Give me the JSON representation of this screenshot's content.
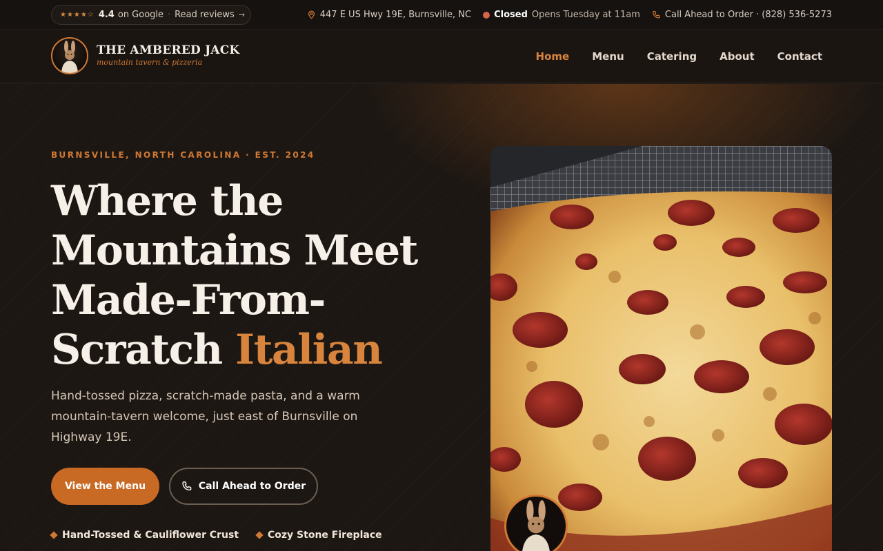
{
  "topbar": {
    "stars": "★★★★☆",
    "rating": "4.4",
    "rating_source": "on Google",
    "reviews_link": "Read reviews",
    "address": "447 E US Hwy 19E, Burnsville, NC",
    "status": "Closed",
    "hours": "Opens Tuesday at 11am",
    "call": "Call Ahead to Order · (828) 536-5273"
  },
  "brand": {
    "name": "THE AMBERED JACK",
    "tagline": "mountain tavern & pizzeria"
  },
  "nav": {
    "items": [
      "Home",
      "Menu",
      "Catering",
      "About",
      "Contact"
    ],
    "active": "Home"
  },
  "hero": {
    "eyebrow": "BURNSVILLE, NORTH CAROLINA · EST. 2024",
    "headline_main": "Where the Mountains Meet Made-From-Scratch",
    "headline_accent": "Italian",
    "subtext": "Hand-tossed pizza, scratch-made pasta, and a warm mountain-tavern welcome, just east of Burnsville on Highway 19E.",
    "primary_cta": "View the Menu",
    "secondary_cta": "Call Ahead to Order",
    "features": [
      "Hand-Tossed & Cauliflower Crust",
      "Cozy Stone Fireplace"
    ]
  },
  "colors": {
    "accent": "#d8843d",
    "button": "#c86a24",
    "background": "#1d1713",
    "status_closed": "#d9624a"
  },
  "icons": {
    "location": "map-pin-icon",
    "phone": "phone-icon",
    "arrow": "arrow-right-icon"
  }
}
